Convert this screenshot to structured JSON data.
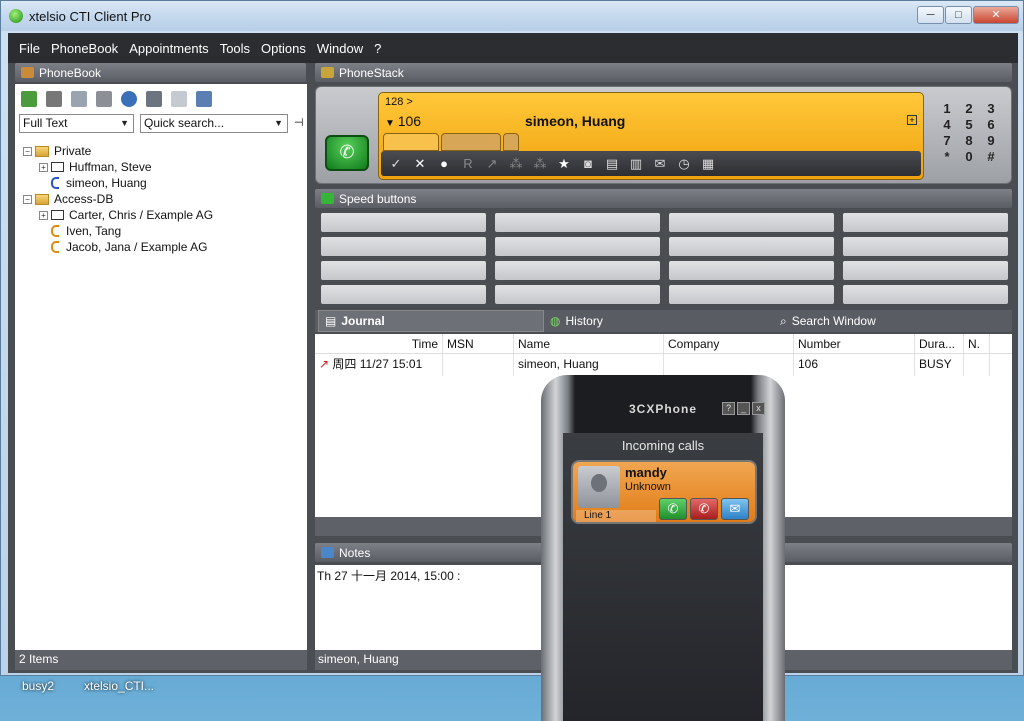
{
  "window": {
    "title": "xtelsio CTI Client Pro",
    "minimize": "─",
    "maximize": "□",
    "close": "✕"
  },
  "menu": [
    "File",
    "PhoneBook",
    "Appointments",
    "Tools",
    "Options",
    "Window",
    "?"
  ],
  "phonebook": {
    "header": "PhoneBook",
    "filter_value": "Full Text",
    "search_placeholder": "Quick search...",
    "tree": [
      {
        "label": "Private",
        "type": "folder",
        "level": 0
      },
      {
        "label": "Huffman, Steve",
        "type": "card",
        "level": 1
      },
      {
        "label": "simeon, Huang",
        "type": "phone",
        "level": 1
      },
      {
        "label": "Access-DB",
        "type": "folder",
        "level": 0
      },
      {
        "label": "Carter, Chris  /  Example AG",
        "type": "card",
        "level": 1
      },
      {
        "label": "Iven, Tang",
        "type": "phone",
        "level": 1
      },
      {
        "label": "Jacob, Jana  /  Example AG",
        "type": "phone",
        "level": 1
      }
    ],
    "status": "2 Items"
  },
  "phonestack": {
    "header": "PhoneStack",
    "line_top": "128 >",
    "extension": "106",
    "caller": "simeon, Huang",
    "keypad": [
      "1",
      "2",
      "3",
      "4",
      "5",
      "6",
      "7",
      "8",
      "9",
      "*",
      "0",
      "#"
    ]
  },
  "speed": {
    "header": "Speed buttons"
  },
  "journal": {
    "tabs": [
      "Journal",
      "History",
      "Search Window"
    ],
    "columns": [
      "Time",
      "MSN",
      "Name",
      "Company",
      "Number",
      "Dura...",
      "N."
    ],
    "rows": [
      {
        "time": "周四 11/27 15:01",
        "msn": "",
        "name": "simeon, Huang",
        "company": "",
        "number": "106",
        "duration": "BUSY",
        "n": ""
      }
    ]
  },
  "notes": {
    "header": "Notes",
    "text": "Th 27 十一月 2014,  15:00 :"
  },
  "status_right": "simeon, Huang",
  "desktop": [
    "busy2",
    "xtelsio_CTI..."
  ],
  "cxphone": {
    "title": "3CXPhone",
    "screen_title": "Incoming calls",
    "caller_name": "mandy",
    "caller_sub": "Unknown",
    "line": "Line 1"
  },
  "colors": {
    "accent": "#f0a20e",
    "green": "#1e8a12",
    "panel": "#4a4d52"
  }
}
